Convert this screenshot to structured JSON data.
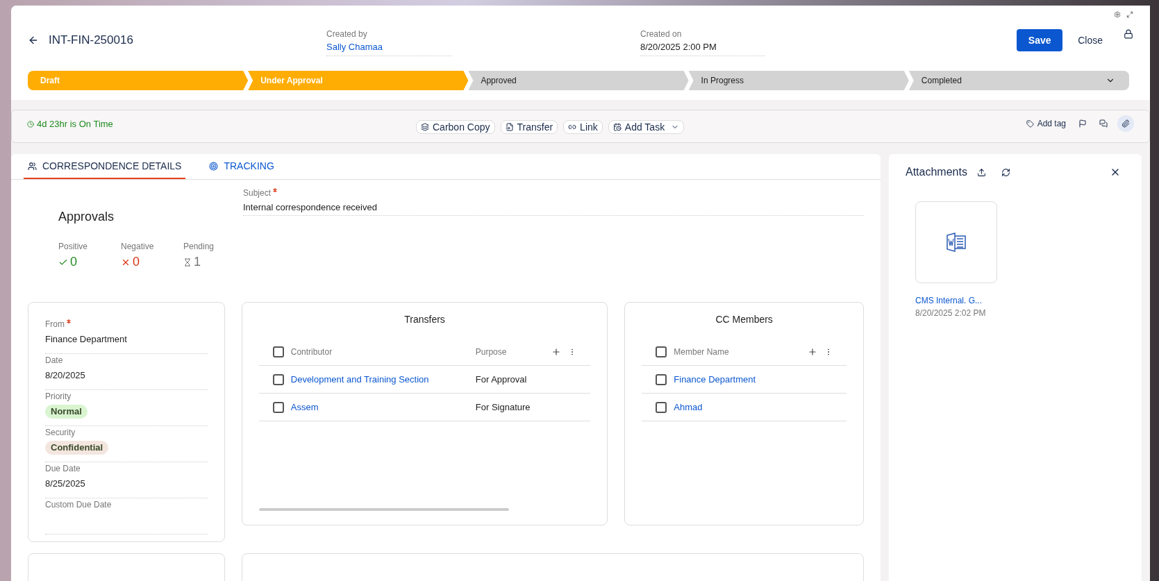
{
  "header": {
    "title": "INT-FIN-250016",
    "created_by": {
      "label": "Created by",
      "value": "Sally Chamaa"
    },
    "created_on": {
      "label": "Created on",
      "value": "8/20/2025 2:00 PM"
    },
    "buttons": [
      "Save",
      "Close"
    ]
  },
  "stages": [
    {
      "label": "Draft",
      "done": true
    },
    {
      "label": "Under Approval",
      "done": true
    },
    {
      "label": "Approved",
      "done": false
    },
    {
      "label": "In Progress",
      "done": false
    },
    {
      "label": "Completed",
      "done": false
    }
  ],
  "toolbar": {
    "status": "4d 23hr is On Time",
    "actions": [
      {
        "label": "Carbon Copy",
        "kind": "layers"
      },
      {
        "label": "Transfer",
        "kind": "transfer"
      },
      {
        "label": "Link",
        "kind": "link"
      },
      {
        "label": "Add Task",
        "kind": "task"
      }
    ],
    "add_tag": "Add tag"
  },
  "tabs": [
    {
      "label": "CORRESPONDENCE DETAILS",
      "selected": true
    },
    {
      "label": "TRACKING",
      "selected": false
    }
  ],
  "approvals": {
    "title": "Approvals",
    "counts": [
      {
        "label": "Positive",
        "value": "0",
        "kind": "positive"
      },
      {
        "label": "Negative",
        "value": "0",
        "kind": "negative"
      },
      {
        "label": "Pending",
        "value": "1",
        "kind": "pending"
      }
    ]
  },
  "subject": {
    "label": "Subject",
    "required": true,
    "value": "Internal correspondence received"
  },
  "fields": [
    {
      "label": "From",
      "required": true,
      "value": "Finance Department",
      "kind": "text"
    },
    {
      "label": "Date",
      "required": false,
      "value": "8/20/2025",
      "kind": "text"
    },
    {
      "label": "Priority",
      "required": false,
      "value": "Normal",
      "kind": "tag",
      "color": "#d8f5d0"
    },
    {
      "label": "Security",
      "required": false,
      "value": "Confidential",
      "kind": "tag",
      "color": "#f3e6de"
    },
    {
      "label": "Due Date",
      "required": false,
      "value": "8/25/2025",
      "kind": "text"
    },
    {
      "label": "Custom Due Date",
      "required": false,
      "kind": "text"
    }
  ],
  "transfers": {
    "title": "Transfers",
    "all_checked": false,
    "columns": [
      "Contributor",
      "Purpose"
    ],
    "rows": [
      {
        "contributor": "Development and Training Section",
        "purpose": "For Approval",
        "checked": false
      },
      {
        "contributor": "Assem",
        "purpose": "For Signature",
        "checked": false
      }
    ]
  },
  "cc_members": {
    "title": "CC Members",
    "all_checked": false,
    "columns": [
      "Member Name"
    ],
    "rows": [
      {
        "name": "Finance Department",
        "checked": false
      },
      {
        "name": "Ahmad",
        "checked": false
      }
    ]
  },
  "attachments": {
    "title": "Attachments",
    "files": [
      {
        "name": "CMS Internal. G...",
        "date": "8/20/2025 2:02 PM"
      }
    ]
  }
}
